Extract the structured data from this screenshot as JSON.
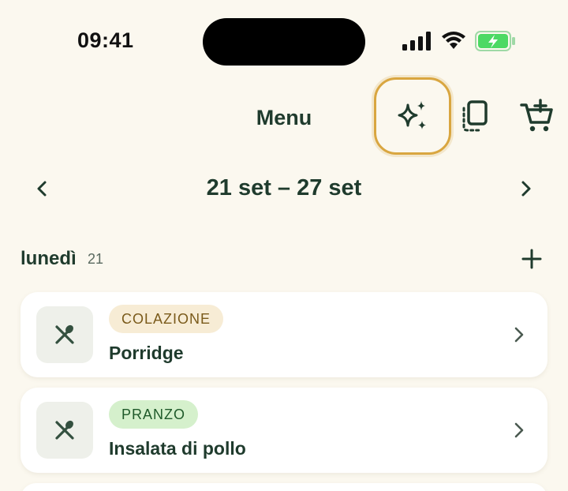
{
  "status_bar": {
    "time": "09:41"
  },
  "header": {
    "title": "Menu",
    "icons": [
      "sparkles-icon",
      "copy-icon",
      "cart-add-icon"
    ]
  },
  "week": {
    "label": "21 set – 27 set"
  },
  "day": {
    "name": "lunedì",
    "number": "21"
  },
  "meals": [
    {
      "tag": "COLAZIONE",
      "name": "Porridge"
    },
    {
      "tag": "PRANZO",
      "name": "Insalata di pollo"
    }
  ],
  "colors": {
    "background": "#fbf8ef",
    "primary_text": "#1f3b2d",
    "highlight_ring": "#d9a640",
    "battery_green": "#4cd964",
    "tag_colazione_bg": "#f7ecd5",
    "tag_pranzo_bg": "#d5f0cc"
  }
}
